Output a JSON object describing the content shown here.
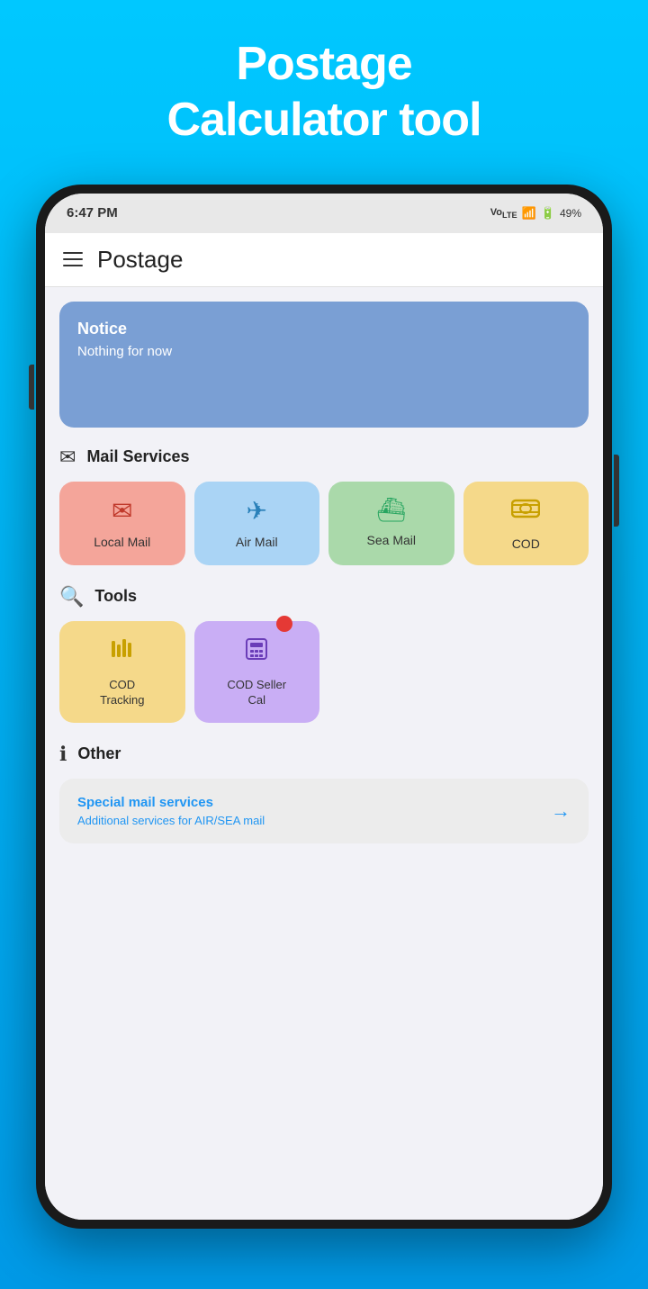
{
  "app": {
    "background_title_line1": "Postage",
    "background_title_line2": "Calculator tool"
  },
  "status_bar": {
    "time": "6:47 PM",
    "network": "VoLTE",
    "signal_bars": "▌▌▌▌",
    "battery_percent": "49%"
  },
  "header": {
    "title": "Postage"
  },
  "notice": {
    "label": "Notice",
    "body": "Nothing for now"
  },
  "mail_services": {
    "section_label": "Mail Services",
    "items": [
      {
        "id": "local-mail",
        "label": "Local Mail",
        "icon": "✉",
        "color_class": "local"
      },
      {
        "id": "air-mail",
        "label": "Air Mail",
        "icon": "✈",
        "color_class": "air"
      },
      {
        "id": "sea-mail",
        "label": "Sea Mail",
        "icon": "🚢",
        "color_class": "sea"
      },
      {
        "id": "cod",
        "label": "COD",
        "icon": "💰",
        "color_class": "cod"
      }
    ]
  },
  "tools": {
    "section_label": "Tools",
    "items": [
      {
        "id": "cod-tracking",
        "label": "COD\nTracking",
        "icon": "▦",
        "color_class": "cod-tracking",
        "has_badge": false
      },
      {
        "id": "cod-seller-cal",
        "label": "COD Seller\nCal",
        "icon": "🖩",
        "color_class": "cod-seller",
        "has_badge": true
      }
    ]
  },
  "other": {
    "section_label": "Other",
    "special_mail": {
      "title": "Special mail services",
      "subtitle": "Additional services for AIR/SEA mail",
      "arrow": "→"
    }
  }
}
